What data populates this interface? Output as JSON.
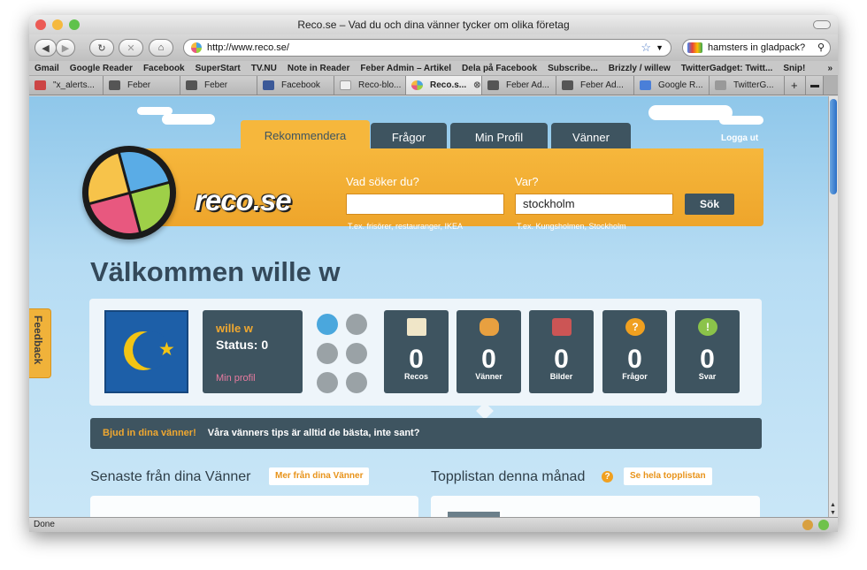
{
  "browser": {
    "window_title": "Reco.se – Vad du och dina vänner tycker om olika företag",
    "url": "http://www.reco.se/",
    "search_value": "hamsters in gladpack?",
    "status": "Done",
    "bookmarks": [
      "Gmail",
      "Google Reader",
      "Facebook",
      "SuperStart",
      "TV.NU",
      "Note in Reader",
      "Feber Admin – Artikel",
      "Dela på Facebook",
      "Subscribe...",
      "Brizzly / willew",
      "TwitterGadget: Twitt...",
      "Snip!"
    ],
    "tabs": [
      {
        "label": "\"x_alerts...",
        "icon": "gmail-icon",
        "color": "#cc4444"
      },
      {
        "label": "Feber",
        "icon": "feber-icon",
        "color": "#555555"
      },
      {
        "label": "Feber",
        "icon": "feber-icon",
        "color": "#555555"
      },
      {
        "label": "Facebook",
        "icon": "facebook-icon",
        "color": "#3b5998"
      },
      {
        "label": "Reco-blo...",
        "icon": "page-icon",
        "color": "#eeeeee"
      },
      {
        "label": "Reco.s...",
        "icon": "reco-icon",
        "color": "#e85a8a"
      },
      {
        "label": "Feber Ad...",
        "icon": "feber-icon",
        "color": "#555555"
      },
      {
        "label": "Feber Ad...",
        "icon": "feber-icon",
        "color": "#555555"
      },
      {
        "label": "Google R...",
        "icon": "google-icon",
        "color": "#4a7fd8"
      },
      {
        "label": "TwitterG...",
        "icon": "twitter-icon",
        "color": "#999999"
      }
    ]
  },
  "site": {
    "logo_text": "reco.se",
    "nav": [
      "Rekommendera",
      "Frågor",
      "Min Profil",
      "Vänner"
    ],
    "logout": "Logga ut",
    "search": {
      "what_label": "Vad söker du?",
      "what_value": "",
      "what_hint": "T.ex. frisörer, restauranger, IKEA",
      "where_label": "Var?",
      "where_value": "stockholm",
      "where_hint": "T.ex. Kungsholmen, Stockholm",
      "button": "Sök"
    },
    "welcome": "Välkommen wille w",
    "profile": {
      "name": "wille w",
      "status": "Status: 0",
      "link": "Min profil"
    },
    "stats": [
      {
        "value": "0",
        "label": "Recos",
        "icon": "pencil-icon",
        "color": "#f0e6c8"
      },
      {
        "value": "0",
        "label": "Vänner",
        "icon": "friends-icon",
        "color": "#e8a040"
      },
      {
        "value": "0",
        "label": "Bilder",
        "icon": "camera-icon",
        "color": "#cc5555"
      },
      {
        "value": "0",
        "label": "Frågor",
        "icon": "question-icon",
        "color": "#f0a020"
      },
      {
        "value": "0",
        "label": "Svar",
        "icon": "exclamation-icon",
        "color": "#8bc34a"
      }
    ],
    "invite": {
      "link": "Bjud in dina vänner!",
      "text": "Våra vänners tips är alltid de bästa, inte sant?"
    },
    "friends_section": {
      "title": "Senaste från dina Vänner",
      "button": "Mer från dina Vänner"
    },
    "toplist_section": {
      "title": "Topplistan denna månad",
      "button": "Se hela topplistan"
    },
    "feedback": "Feedback",
    "colors": {
      "accent_orange": "#eea52b",
      "dark_slate": "#3e5460",
      "sky": "#a6d6f0",
      "pink": "#e87ba0"
    }
  }
}
